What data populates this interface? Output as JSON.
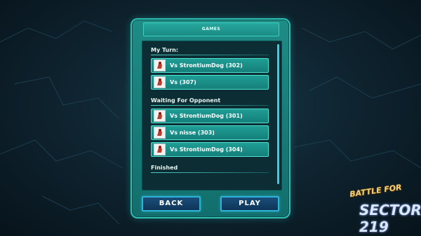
{
  "panel": {
    "title": "GAMES"
  },
  "sections": [
    {
      "label": "My Turn:"
    },
    {
      "label": "Waiting For Opponent"
    },
    {
      "label": "Finished"
    }
  ],
  "my_turn": [
    {
      "label": "Vs StrontiumDog (302)"
    },
    {
      "label": "Vs  (307)"
    }
  ],
  "waiting": [
    {
      "label": "Vs StrontiumDog (301)"
    },
    {
      "label": "Vs nisse (303)"
    },
    {
      "label": "Vs StrontiumDog (304)"
    }
  ],
  "buttons": {
    "back": "BACK",
    "play": "PLAY"
  },
  "logo": {
    "line1": "BATTLE FOR",
    "line2": "SECTOR 219"
  },
  "colors": {
    "panel": "#1a8a84",
    "item": "#1f9d95",
    "button": "#1a4e7a",
    "button_border": "#2db2d8"
  },
  "icons": {
    "avatar": "player-avatar-icon"
  }
}
